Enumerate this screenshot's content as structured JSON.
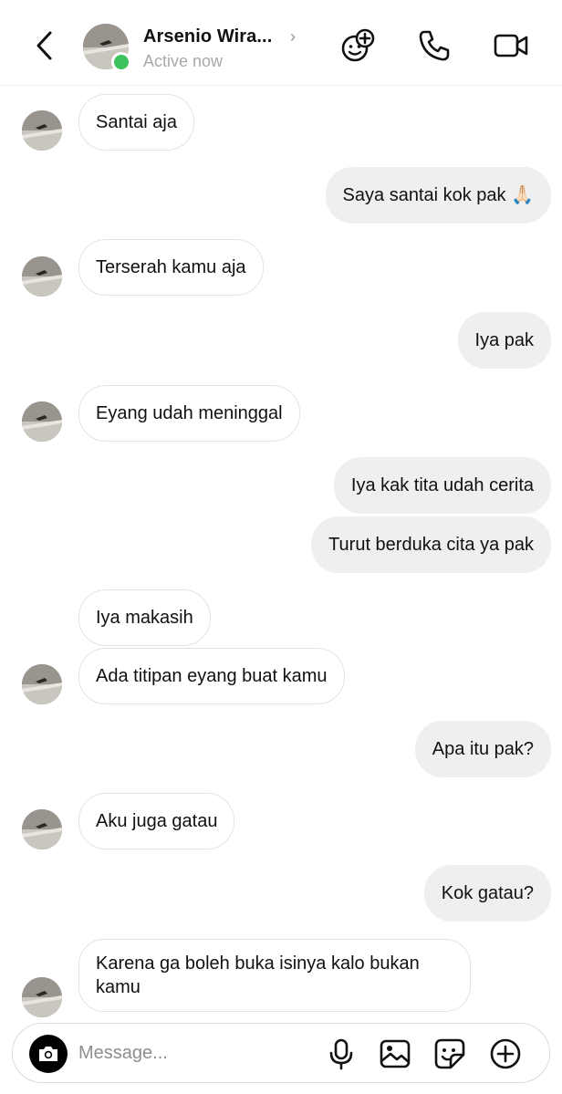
{
  "header": {
    "contact_name": "Arsenio Wira...",
    "status": "Active now",
    "chevron": "›",
    "icons": [
      "back-chevron-icon",
      "avatar",
      "online-dot",
      "effects-icon",
      "phone-icon",
      "video-call-icon"
    ]
  },
  "messages": [
    {
      "side": "in",
      "text": "Santai aja",
      "show_avatar": true
    },
    {
      "side": "out",
      "text": "Saya santai kok pak 🙏🏻"
    },
    {
      "side": "in",
      "text": "Terserah kamu aja",
      "show_avatar": true
    },
    {
      "side": "out",
      "text": "Iya pak"
    },
    {
      "side": "in",
      "text": "Eyang udah meninggal",
      "show_avatar": true
    },
    {
      "side": "out",
      "text": "Iya kak tita udah cerita"
    },
    {
      "side": "out",
      "text": "Turut berduka cita ya pak"
    },
    {
      "side": "in",
      "text": "Iya makasih",
      "show_avatar": false
    },
    {
      "side": "in",
      "text": "Ada titipan eyang buat kamu",
      "show_avatar": true
    },
    {
      "side": "out",
      "text": "Apa itu pak?"
    },
    {
      "side": "in",
      "text": "Aku juga gatau",
      "show_avatar": true
    },
    {
      "side": "out",
      "text": "Kok gatau?"
    },
    {
      "side": "in",
      "text": "Karena ga boleh buka isinya kalo bukan kamu",
      "show_avatar": true
    }
  ],
  "composer": {
    "placeholder": "Message...",
    "icons": [
      "camera-icon",
      "microphone-icon",
      "gallery-icon",
      "sticker-icon",
      "plus-icon"
    ]
  },
  "colors": {
    "online": "#3dc35d",
    "incoming_bubble": "#ffffff",
    "outgoing_bubble": "#efefef",
    "secondary_text": "#a8a8a8"
  }
}
